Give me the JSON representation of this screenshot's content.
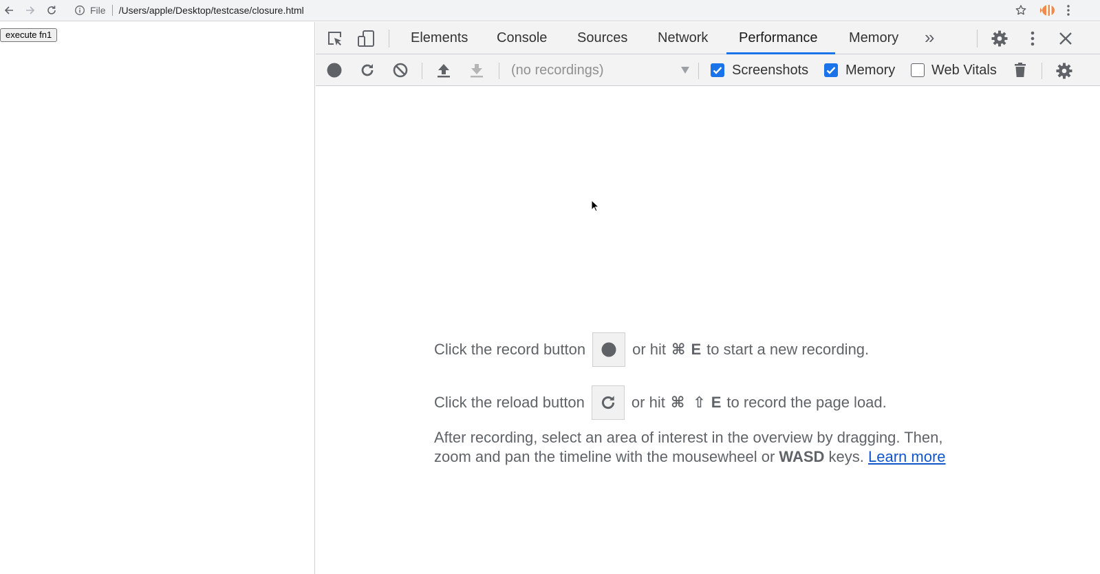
{
  "browser": {
    "scheme": "File",
    "url": "/Users/apple/Desktop/testcase/closure.html"
  },
  "page": {
    "button_label": "execute fn1"
  },
  "devtools": {
    "tabs": [
      {
        "label": "Elements"
      },
      {
        "label": "Console"
      },
      {
        "label": "Sources"
      },
      {
        "label": "Network"
      },
      {
        "label": "Performance",
        "active": true
      },
      {
        "label": "Memory"
      }
    ],
    "overflow_label": "»",
    "toolbar": {
      "recordings_select": "(no recordings)",
      "checkboxes": [
        {
          "label": "Screenshots",
          "checked": true
        },
        {
          "label": "Memory",
          "checked": true
        },
        {
          "label": "Web Vitals",
          "checked": false
        }
      ]
    },
    "landing": {
      "record_prefix": "Click the record button",
      "record_hit": "or hit",
      "record_cmd": "⌘",
      "record_key": "E",
      "record_suffix": "to start a new recording.",
      "reload_prefix": "Click the reload button",
      "reload_hit": "or hit",
      "reload_cmd": "⌘",
      "reload_shift": "⇧",
      "reload_key": "E",
      "reload_suffix": "to record the page load.",
      "para_text_1": "After recording, select an area of interest in the overview by dragging. Then, zoom and pan the timeline with the mousewheel or",
      "para_bold": "WASD",
      "para_text_2": "keys.",
      "learn_more": "Learn more"
    }
  },
  "colors": {
    "accent": "#1a73e8",
    "link": "#1155cc",
    "toolbar_bg": "#f3f3f3",
    "icon": "#5f6368"
  }
}
